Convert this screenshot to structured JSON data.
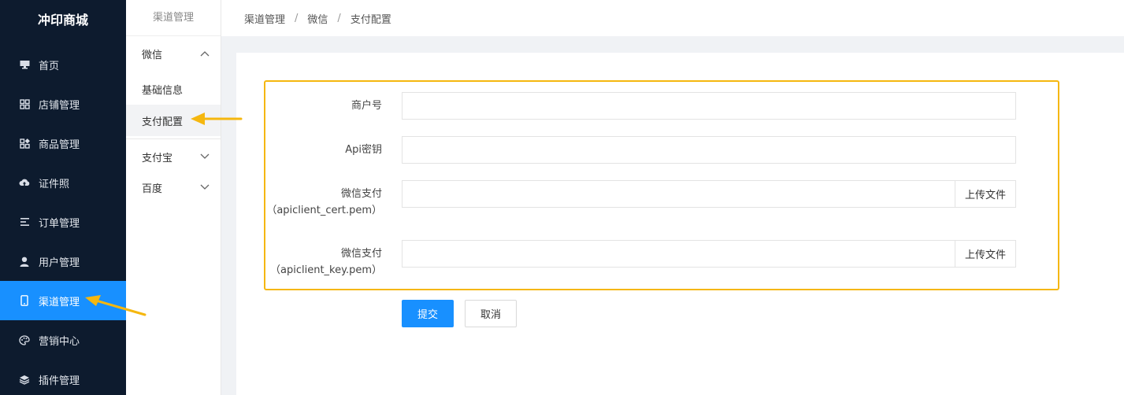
{
  "app": {
    "title": "冲印商城"
  },
  "colors": {
    "sidebar_bg": "#0d1b2e",
    "accent": "#1890ff",
    "highlight": "#f5b70f"
  },
  "sidebar": {
    "items": [
      {
        "label": "首页",
        "icon": "monitor-icon"
      },
      {
        "label": "店铺管理",
        "icon": "grid-icon"
      },
      {
        "label": "商品管理",
        "icon": "apps-icon"
      },
      {
        "label": "证件照",
        "icon": "cloud-upload-icon"
      },
      {
        "label": "订单管理",
        "icon": "list-icon"
      },
      {
        "label": "用户管理",
        "icon": "user-icon"
      },
      {
        "label": "渠道管理",
        "icon": "mobile-icon",
        "active": true
      },
      {
        "label": "营销中心",
        "icon": "palette-icon"
      },
      {
        "label": "插件管理",
        "icon": "layers-icon"
      }
    ]
  },
  "submenu": {
    "title": "渠道管理",
    "groups": [
      {
        "label": "微信",
        "expanded": true,
        "items": [
          {
            "label": "基础信息"
          },
          {
            "label": "支付配置",
            "active": true
          }
        ]
      },
      {
        "label": "支付宝",
        "expanded": false
      },
      {
        "label": "百度",
        "expanded": false
      }
    ]
  },
  "breadcrumb": {
    "items": [
      "渠道管理",
      "微信",
      "支付配置"
    ],
    "separator": "/"
  },
  "form": {
    "merchant_id": {
      "label": "商户号",
      "value": ""
    },
    "api_key": {
      "label": "Api密钥",
      "value": ""
    },
    "cert_file": {
      "label_line1": "微信支付",
      "label_line2": "（apiclient_cert.pem）",
      "value": "",
      "button": "上传文件"
    },
    "key_file": {
      "label_line1": "微信支付",
      "label_line2": "（apiclient_key.pem）",
      "value": "",
      "button": "上传文件"
    },
    "submit": "提交",
    "cancel": "取消"
  }
}
